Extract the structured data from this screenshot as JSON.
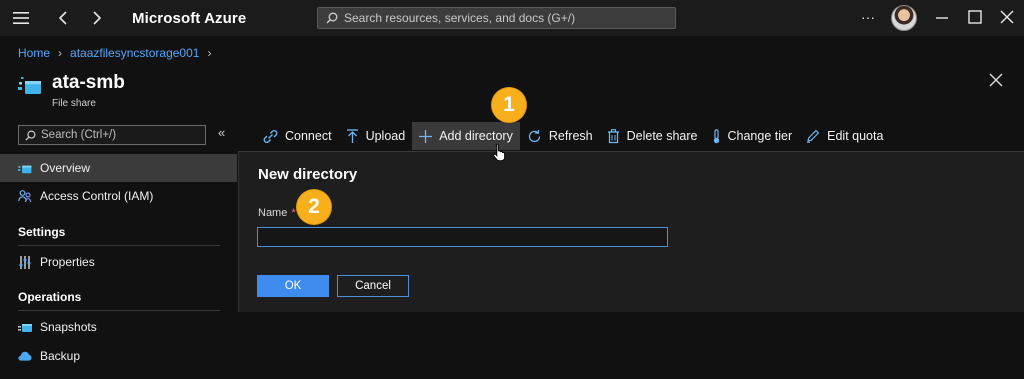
{
  "topbar": {
    "brand": "Microsoft Azure",
    "search_placeholder": "Search resources, services, and docs (G+/)",
    "more_label": "···"
  },
  "breadcrumb": {
    "items": [
      "Home",
      "ataazfilesyncstorage001"
    ]
  },
  "resource": {
    "title": "ata-smb",
    "subtitle": "File share"
  },
  "sidebar": {
    "search_placeholder": "Search (Ctrl+/)",
    "collapse_label": "«",
    "items": [
      {
        "label": "Overview",
        "icon": "file-share-icon",
        "active": true
      },
      {
        "label": "Access Control (IAM)",
        "icon": "people-icon",
        "active": false
      }
    ],
    "section_settings": "Settings",
    "settings_items": [
      {
        "label": "Properties",
        "icon": "properties-icon"
      }
    ],
    "section_operations": "Operations",
    "operations_items": [
      {
        "label": "Snapshots",
        "icon": "snapshots-icon"
      },
      {
        "label": "Backup",
        "icon": "backup-icon"
      }
    ]
  },
  "toolbar": {
    "connect": "Connect",
    "upload": "Upload",
    "add_directory": "Add directory",
    "refresh": "Refresh",
    "delete_share": "Delete share",
    "change_tier": "Change tier",
    "edit_quota": "Edit quota"
  },
  "panel": {
    "title": "New directory",
    "name_label": "Name",
    "required_marker": "*",
    "name_value": "",
    "ok_label": "OK",
    "cancel_label": "Cancel"
  },
  "callouts": {
    "one": "1",
    "two": "2"
  },
  "colors": {
    "accent": "#3f8cef",
    "link": "#4fa7ff",
    "callout": "#f7b01c"
  }
}
